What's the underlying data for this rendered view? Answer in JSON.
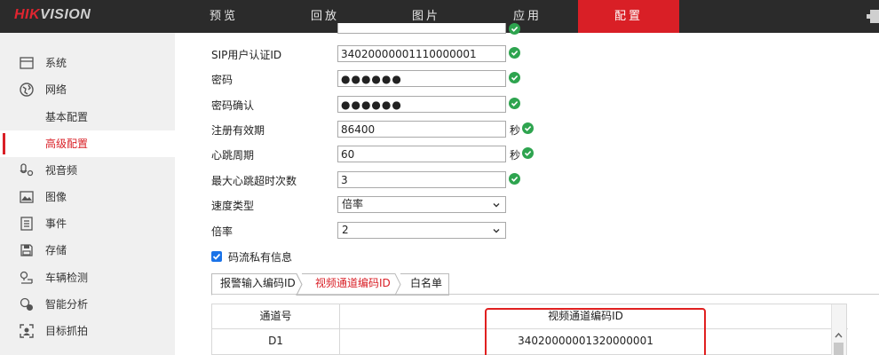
{
  "logo": {
    "part1": "HIK",
    "part2": "VISION"
  },
  "nav": [
    {
      "label": "预览"
    },
    {
      "label": "回放"
    },
    {
      "label": "图片"
    },
    {
      "label": "应用"
    },
    {
      "label": "配置",
      "active": true
    }
  ],
  "sidebar": {
    "items": [
      {
        "label": "系统",
        "icon": "monitor-icon"
      },
      {
        "label": "网络",
        "icon": "globe-icon"
      },
      {
        "label": "基本配置"
      },
      {
        "label": "高级配置",
        "active": true
      },
      {
        "label": "视音频",
        "icon": "mic-icon"
      },
      {
        "label": "图像",
        "icon": "image-icon"
      },
      {
        "label": "事件",
        "icon": "list-icon"
      },
      {
        "label": "存储",
        "icon": "save-icon"
      },
      {
        "label": "车辆检测",
        "icon": "car-icon"
      },
      {
        "label": "智能分析",
        "icon": "smart-icon"
      },
      {
        "label": "目标抓拍",
        "icon": "target-icon"
      }
    ]
  },
  "form": {
    "sip_user_id_label": "SIP用户认证ID",
    "sip_user_id_value": "34020000001110000001",
    "password_label": "密码",
    "password_value": "●●●●●●",
    "password_confirm_label": "密码确认",
    "password_confirm_value": "●●●●●●",
    "reg_expiry_label": "注册有效期",
    "reg_expiry_value": "86400",
    "reg_expiry_unit": "秒",
    "heartbeat_label": "心跳周期",
    "heartbeat_value": "60",
    "heartbeat_unit": "秒",
    "max_timeout_label": "最大心跳超时次数",
    "max_timeout_value": "3",
    "speed_type_label": "速度类型",
    "speed_type_value": "倍率",
    "rate_label": "倍率",
    "rate_value": "2",
    "private_info_label": "码流私有信息"
  },
  "tabs": [
    {
      "label": "报警输入编码ID"
    },
    {
      "label": "视频通道编码ID",
      "active": true
    },
    {
      "label": "白名单"
    }
  ],
  "table": {
    "headers": [
      "通道号",
      "视频通道编码ID"
    ],
    "rows": [
      [
        "D1",
        "34020000001320000001"
      ]
    ]
  },
  "colors": {
    "accent": "#d91f26",
    "ok": "#2ea44f",
    "highlight": "#e02020"
  }
}
